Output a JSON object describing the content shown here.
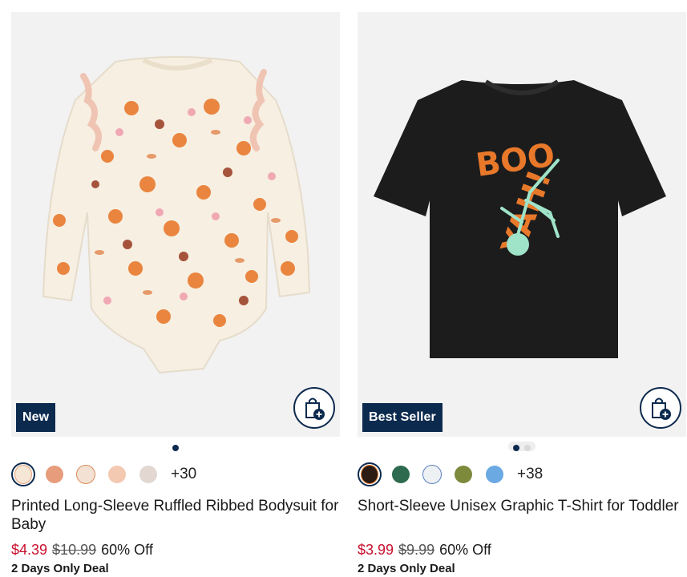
{
  "products": [
    {
      "badge": "New",
      "title": "Printed Long-Sleeve Ruffled Ribbed Bodysuit for Baby",
      "sale_price": "$4.39",
      "original_price": "$10.99",
      "discount": "60% Off",
      "deal": "2 Days Only Deal",
      "more_colors": "+30",
      "dots": 1,
      "active_dot": 0,
      "swatch_colors": [
        "#f6e6d6",
        "#e79c7b",
        "#f3e2d4",
        "#f3c9b2",
        "#e2d7d1"
      ]
    },
    {
      "badge": "Best Seller",
      "title": "Short-Sleeve Unisex Graphic T-Shirt for Toddler",
      "sale_price": "$3.99",
      "original_price": "$9.99",
      "discount": "60% Off",
      "deal": "2 Days Only Deal",
      "more_colors": "+38",
      "dots": 2,
      "active_dot": 0,
      "swatch_colors": [
        "#2b1b12",
        "#2e6b4e",
        "#eef1f4",
        "#7d8a3c",
        "#6ba9e2"
      ]
    }
  ],
  "icons": {
    "bag": "shopping-bag-plus-icon"
  },
  "colors": {
    "navy": "#0c2a4e",
    "sale": "#c8102e"
  }
}
